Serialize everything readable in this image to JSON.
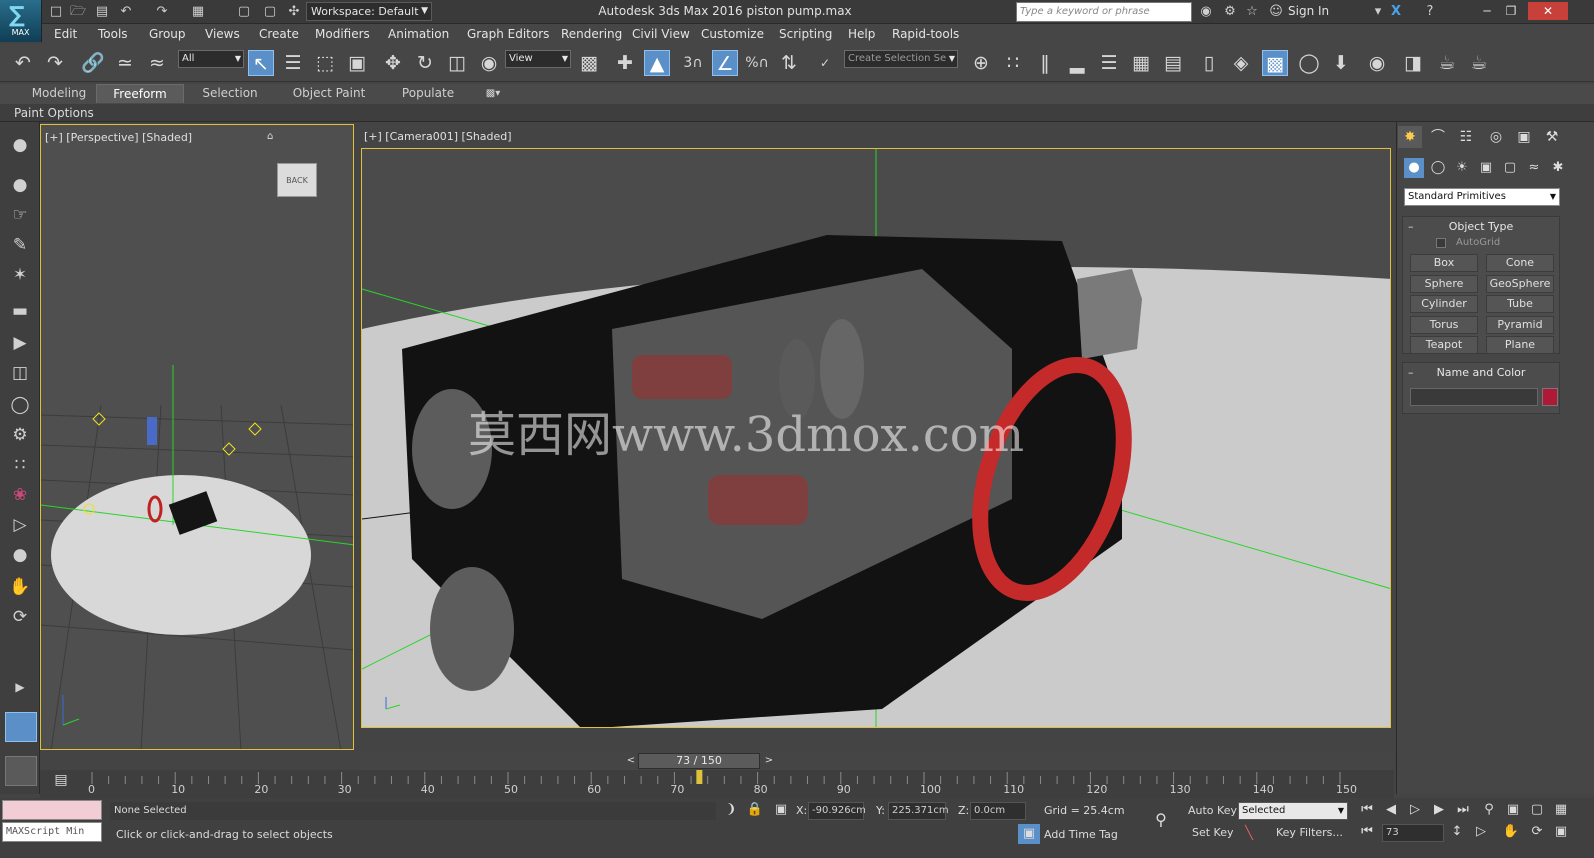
{
  "app": {
    "logo_label": "MAX",
    "workspace": "Workspace: Default",
    "title": "Autodesk 3ds Max 2016    piston pump.max",
    "search_placeholder": "Type a keyword or phrase",
    "sign_in": "Sign In"
  },
  "menu": [
    "Edit",
    "Tools",
    "Group",
    "Views",
    "Create",
    "Modifiers",
    "Animation",
    "Graph Editors",
    "Rendering",
    "Civil View",
    "Customize",
    "Scripting",
    "Help",
    "Rapid-tools"
  ],
  "toolbar": {
    "filter": "All",
    "ref_coord": "View",
    "selection_set": "Create Selection Se",
    "snap_label": "3",
    "angle_snap_label": "%"
  },
  "ribbon": {
    "tabs": [
      "Modeling",
      "Freeform",
      "Selection",
      "Object Paint",
      "Populate"
    ],
    "active": "Freeform",
    "panel": "Paint Options"
  },
  "viewports": {
    "left_label": "[+] [Perspective] [Shaded]",
    "main_label": "[+] [Camera001] [Shaded]",
    "watermark": "莫西网www.3dmox.com",
    "viewcube_label": "BACK"
  },
  "command_panel": {
    "category": "Standard Primitives",
    "object_type_title": "Object Type",
    "autogrid": "AutoGrid",
    "primitives": [
      "Box",
      "Cone",
      "Sphere",
      "GeoSphere",
      "Cylinder",
      "Tube",
      "Torus",
      "Pyramid",
      "Teapot",
      "Plane"
    ],
    "name_color_title": "Name and Color",
    "swatch_color": "#b01838"
  },
  "timeline": {
    "frame_display": "73 / 150",
    "prev": "<",
    "next": ">",
    "ticks": [
      "0",
      "10",
      "20",
      "30",
      "40",
      "50",
      "60",
      "70",
      "80",
      "90",
      "100",
      "110",
      "120",
      "130",
      "140",
      "150"
    ],
    "current_frame": 73
  },
  "status": {
    "maxscript": "MAXScript Min",
    "selection": "None Selected",
    "prompt": "Click or click-and-drag to select objects",
    "x_label": "X:",
    "x_value": "-90.926cm",
    "y_label": "Y:",
    "y_value": "225.371cm",
    "z_label": "Z:",
    "z_value": "0.0cm",
    "grid": "Grid = 25.4cm",
    "add_time_tag": "Add Time Tag",
    "auto_key": "Auto Key",
    "key_mode": "Selected",
    "set_key": "Set Key",
    "key_filters": "Key Filters...",
    "frame_field": "73"
  }
}
